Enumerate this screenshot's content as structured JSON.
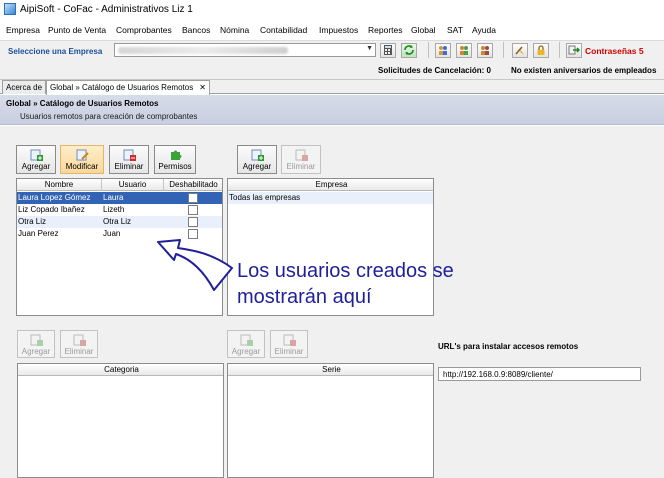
{
  "window": {
    "title": "AipiSoft - CoFac - Administrativos Liz 1"
  },
  "menu": [
    "Empresa",
    "Punto de Venta",
    "Comprobantes",
    "Bancos",
    "Nómina",
    "Contabilidad",
    "Impuestos",
    "Reportes",
    "Global",
    "SAT",
    "Ayuda"
  ],
  "toolbar": {
    "empresa_label": "Seleccione una Empresa",
    "contrasenas_label": "Contraseñas 5",
    "solicitudes_label": "Solicitudes de Cancelación: 0",
    "aniversarios_label": "No existen aniversarios de empleados",
    "icons": [
      "calculator-icon",
      "refresh-icon",
      "user-group-icon-1",
      "user-group-icon-2",
      "user-group-icon-3",
      "broom-icon",
      "lock-icon",
      "exit-icon"
    ]
  },
  "tabs": [
    {
      "label": "Acerca de"
    },
    {
      "label": "Global » Catálogo de Usuarios Remotos",
      "close": "✕"
    }
  ],
  "header": {
    "title": "Global » Catálogo de Usuarios Remotos",
    "subtitle": "Usuarios remotos para creación de comprobantes"
  },
  "users_panel": {
    "buttons": {
      "agregar": "Agregar",
      "modificar": "Modificar",
      "eliminar": "Eliminar",
      "permisos": "Permisos"
    },
    "columns": [
      "Nombre",
      "Usuario",
      "Deshabilitado"
    ],
    "rows": [
      {
        "nombre": "Laura Lopez Gómez",
        "usuario": "Laura",
        "deshabilitado": false
      },
      {
        "nombre": "Liz Copado Ibañez",
        "usuario": "Lizeth",
        "deshabilitado": false
      },
      {
        "nombre": "Otra Liz",
        "usuario": "Otra Liz",
        "deshabilitado": false
      },
      {
        "nombre": "Juan Perez",
        "usuario": "Juan",
        "deshabilitado": false
      }
    ]
  },
  "empresa_panel": {
    "buttons": {
      "agregar": "Agregar",
      "eliminar": "Eliminar"
    },
    "column": "Empresa",
    "rows": [
      "Todas las empresas"
    ]
  },
  "callout": {
    "line1": "Los usuarios creados se",
    "line2": "mostrarán aquí"
  },
  "categoria_panel": {
    "buttons": {
      "agregar": "Agregar",
      "eliminar": "Eliminar"
    },
    "column": "Categoria"
  },
  "serie_panel": {
    "buttons": {
      "agregar": "Agregar",
      "eliminar": "Eliminar"
    },
    "column": "Serie"
  },
  "urls": {
    "label": "URL's para instalar accesos remotos",
    "value": "http://192.168.0.9:8089/cliente/"
  },
  "colors": {
    "accent": "#3363b4",
    "callout": "#1f1f9b",
    "alert": "#d00000"
  }
}
